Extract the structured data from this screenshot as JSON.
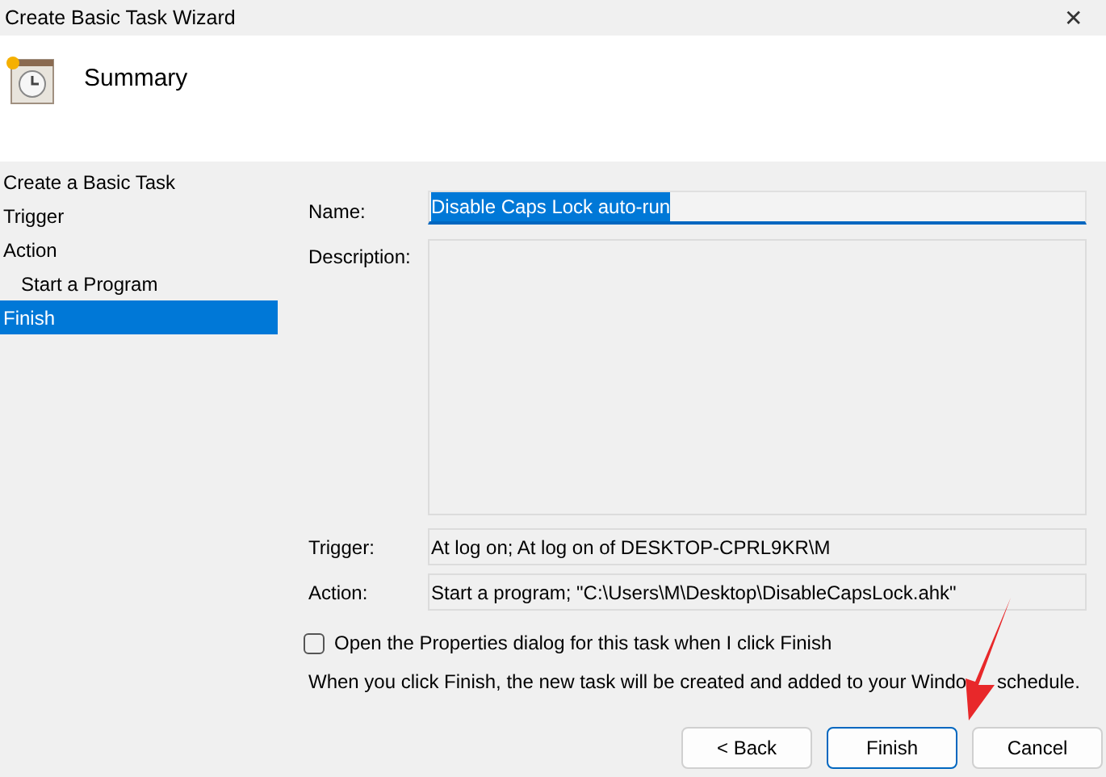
{
  "window": {
    "title": "Create Basic Task Wizard",
    "close": "✕"
  },
  "header": {
    "title": "Summary"
  },
  "steps": [
    {
      "label": "Create a Basic Task",
      "selected": false
    },
    {
      "label": "Trigger",
      "selected": false
    },
    {
      "label": "Action",
      "selected": false,
      "children": [
        {
          "label": "Start a Program",
          "selected": false
        }
      ]
    },
    {
      "label": "Finish",
      "selected": true
    }
  ],
  "form": {
    "name_label": "Name:",
    "name_value": "Disable Caps Lock auto-run",
    "description_label": "Description:",
    "trigger_label": "Trigger:",
    "trigger_value": "At log on; At log on of DESKTOP-CPRL9KR\\M",
    "action_label": "Action:",
    "action_value": "Start a program; \"C:\\Users\\M\\Desktop\\DisableCapsLock.ahk\""
  },
  "open_properties": {
    "label": "Open the Properties dialog for this task when I click Finish",
    "checked": false
  },
  "note": [
    "When you click Finish, the new task will be created and added to your Windo",
    "schedule."
  ],
  "buttons": [
    {
      "label": "< Back",
      "kind": "normal"
    },
    {
      "label": "Finish",
      "kind": "default"
    },
    {
      "label": "Cancel",
      "kind": "normal"
    }
  ]
}
